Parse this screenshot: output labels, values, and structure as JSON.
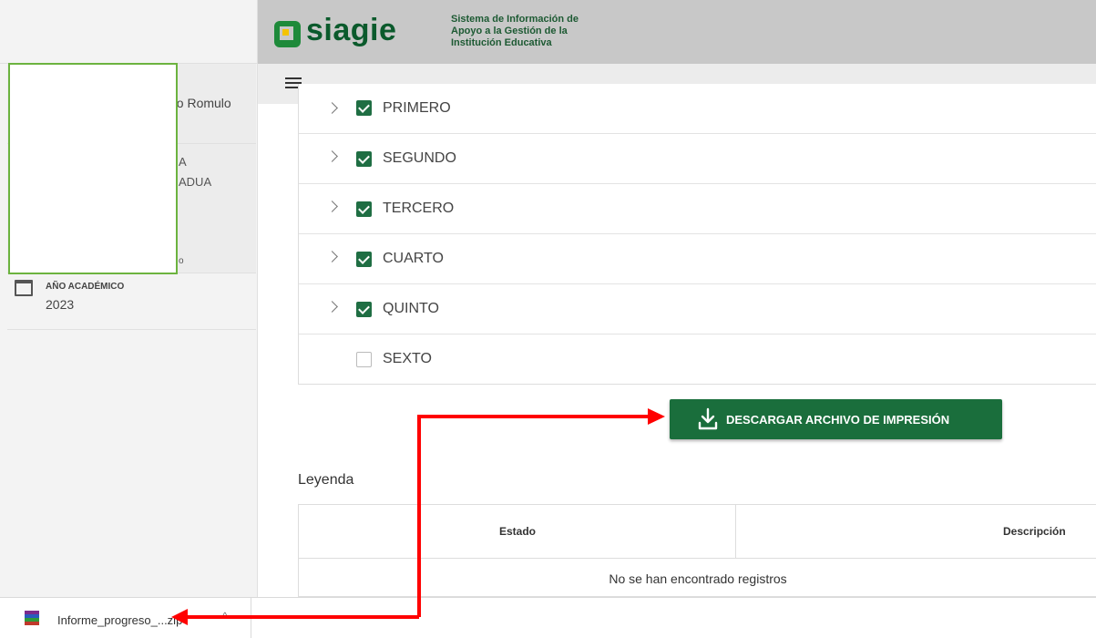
{
  "header": {
    "logo_text": "siagie",
    "subtitle_line1": "Sistema de Información de",
    "subtitle_line2": "Apoyo a la Gestión de la",
    "subtitle_line3": "Institución Educativa"
  },
  "sidebar": {
    "user_name_fragment": "no Romulo",
    "fragment1": "A",
    "fragment2": "ADUA",
    "fragment3": "o",
    "academic_year_label": "AÑO ACADÉMICO",
    "academic_year_value": "2023"
  },
  "grades": [
    {
      "label": "PRIMERO",
      "checked": true
    },
    {
      "label": "SEGUNDO",
      "checked": true
    },
    {
      "label": "TERCERO",
      "checked": true
    },
    {
      "label": "CUARTO",
      "checked": true
    },
    {
      "label": "QUINTO",
      "checked": true
    },
    {
      "label": "SEXTO",
      "checked": false
    }
  ],
  "download_button": {
    "label": "DESCARGAR ARCHIVO DE IMPRESIÓN"
  },
  "legend": {
    "title": "Leyenda",
    "col_estado": "Estado",
    "col_descripcion": "Descripción",
    "empty_message": "No se han encontrado registros"
  },
  "download_bar": {
    "file_name": "Informe_progreso_...zip",
    "more_glyph": "^"
  },
  "colors": {
    "brand_green": "#1a6e3c",
    "annotation_red": "#ff0000",
    "highlight_green": "#6cb33f"
  }
}
